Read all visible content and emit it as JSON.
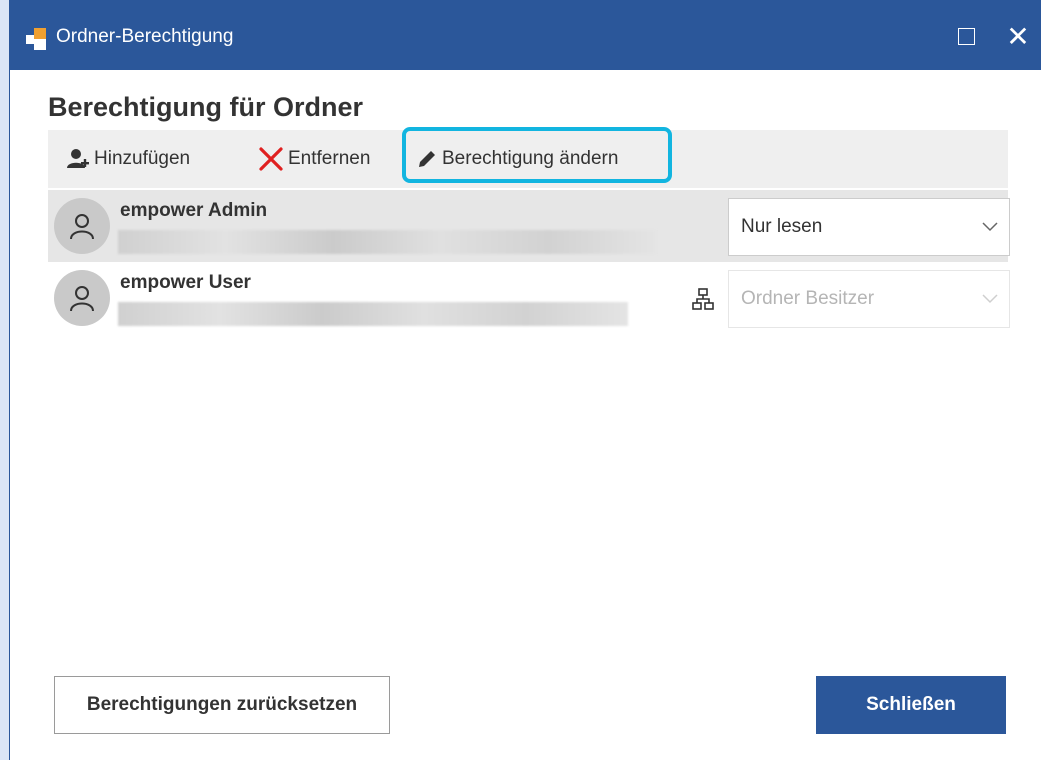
{
  "window": {
    "title": "Ordner-Berechtigung",
    "accent": "#2b579a"
  },
  "page": {
    "heading": "Berechtigung für Ordner"
  },
  "toolbar": {
    "add_label": "Hinzufügen",
    "remove_label": "Entfernen",
    "edit_label": "Berechtigung ändern",
    "highlight_color": "#12b5e0"
  },
  "permissions": [
    {
      "name": "empower Admin",
      "permission": "Nur lesen",
      "inherited": false
    },
    {
      "name": "empower User",
      "permission": "Ordner Besitzer",
      "inherited": true
    }
  ],
  "footer": {
    "reset_label": "Berechtigungen zurücksetzen",
    "close_label": "Schließen"
  }
}
